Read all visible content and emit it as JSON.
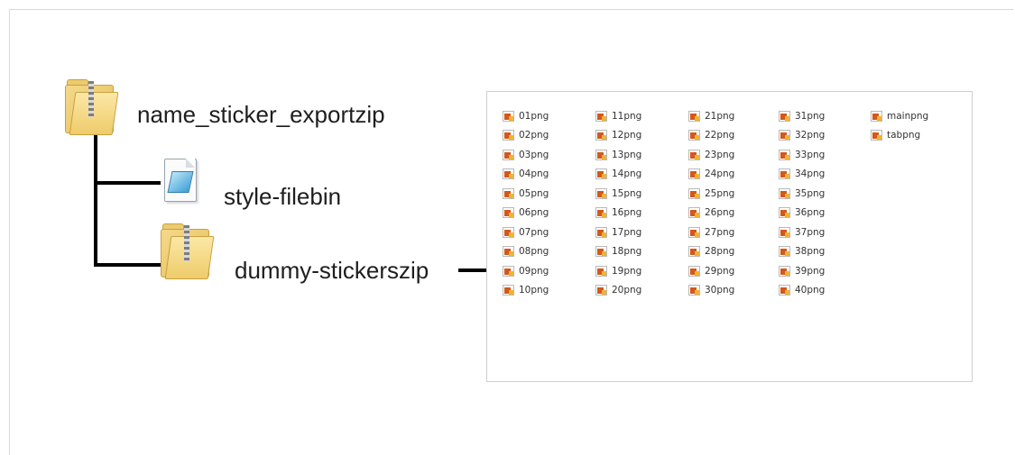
{
  "tree": {
    "root": {
      "name": "name_sticker_exportzip",
      "icon": "zip-folder-icon"
    },
    "children": [
      {
        "name": "style-filebin",
        "icon": "bin-file-icon"
      },
      {
        "name": "dummy-stickerszip",
        "icon": "zip-folder-icon"
      }
    ]
  },
  "contents_panel": {
    "columns": [
      [
        "01png",
        "02png",
        "03png",
        "04png",
        "05png",
        "06png",
        "07png",
        "08png",
        "09png",
        "10png"
      ],
      [
        "11png",
        "12png",
        "13png",
        "14png",
        "15png",
        "16png",
        "17png",
        "18png",
        "19png",
        "20png"
      ],
      [
        "21png",
        "22png",
        "23png",
        "24png",
        "25png",
        "26png",
        "27png",
        "28png",
        "29png",
        "30png"
      ],
      [
        "31png",
        "32png",
        "33png",
        "34png",
        "35png",
        "36png",
        "37png",
        "38png",
        "39png",
        "40png"
      ],
      [
        "mainpng",
        "tabpng"
      ]
    ],
    "item_icon": "png-image-icon"
  }
}
